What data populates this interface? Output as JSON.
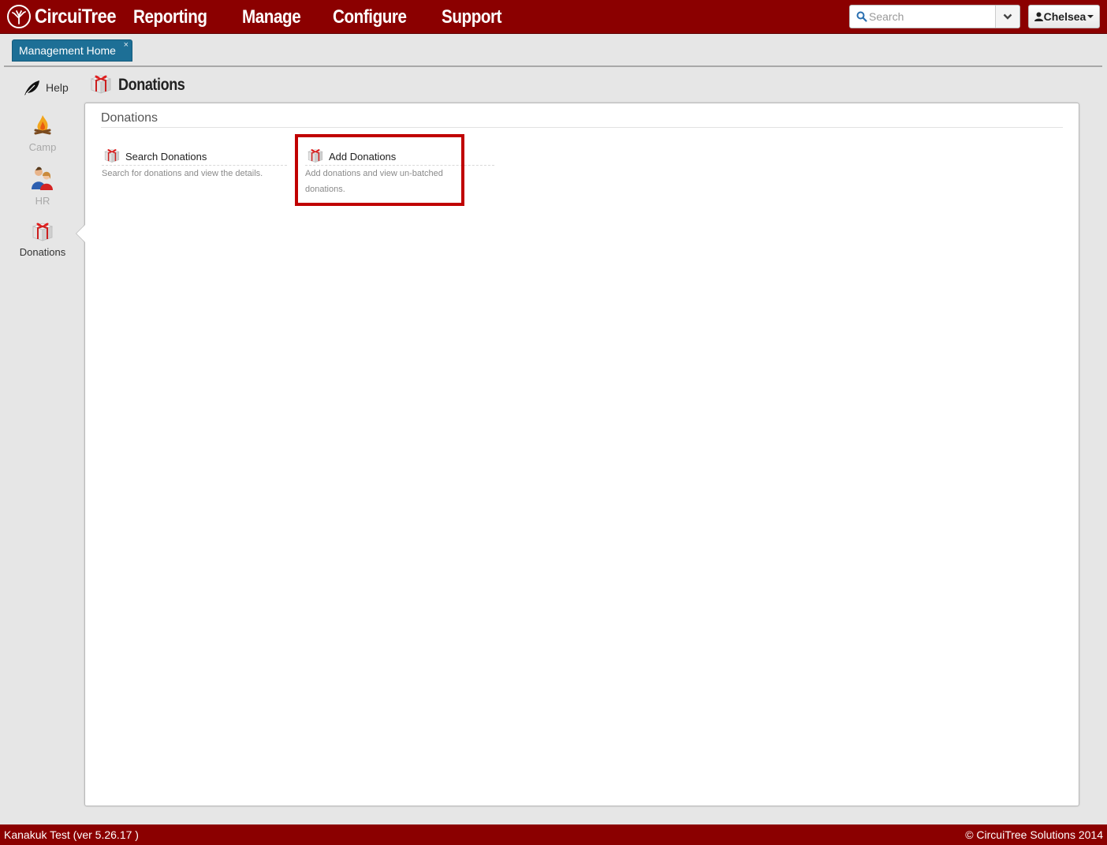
{
  "header": {
    "brand": "CircuiTree",
    "nav": [
      "Reporting",
      "Manage",
      "Configure",
      "Support"
    ],
    "search_placeholder": "Search",
    "user": "Chelsea"
  },
  "tabs": [
    {
      "label": "Management Home",
      "close": "×"
    }
  ],
  "sidebar": {
    "help": "Help",
    "items": [
      {
        "label": "Camp"
      },
      {
        "label": "HR"
      },
      {
        "label": "Donations"
      }
    ]
  },
  "page": {
    "title": "Donations",
    "section_title": "Donations",
    "actions": [
      {
        "title": "Search Donations",
        "description": "Search for donations and view the details."
      },
      {
        "title": "Add Donations",
        "description": "Add donations and view un-batched donations."
      }
    ]
  },
  "footer": {
    "left": "Kanakuk Test (ver 5.26.17 )",
    "right": "© CircuiTree Solutions 2014"
  },
  "colors": {
    "brand": "#8b0000",
    "tab": "#1d6f96",
    "highlight": "#c00000"
  }
}
